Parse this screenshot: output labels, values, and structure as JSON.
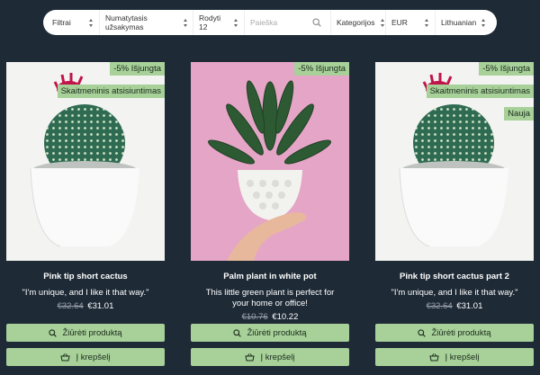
{
  "toolbar": {
    "filters": "Filtrai",
    "sort": "Numatytasis užsakymas",
    "show": "Rodyti 12",
    "search_placeholder": "Paieška",
    "categories": "Kategorijos",
    "currency": "EUR",
    "language": "Lithuanian"
  },
  "colors": {
    "background": "#1e2a36",
    "accent": "#a7d199"
  },
  "products": [
    {
      "title": "Pink tip short cactus",
      "description": "\"I'm unique, and I like it that way.\"",
      "old_price": "€32.64",
      "price": "€31.01",
      "badges": [
        "-5% Išjungta",
        "Skaitmeninis atsisiuntimas"
      ],
      "view_label": "Žiūrėti produktą",
      "cart_label": "Į krepšelį"
    },
    {
      "title": "Palm plant in white pot",
      "description": "This little green plant is perfect for your home or office!",
      "old_price": "€10.76",
      "price": "€10.22",
      "badges": [
        "-5% Išjungta"
      ],
      "view_label": "Žiūrėti produktą",
      "cart_label": "Į krepšelį"
    },
    {
      "title": "Pink tip short cactus part 2",
      "description": "\"I'm unique, and I like it that way.\"",
      "old_price": "€32.64",
      "price": "€31.01",
      "badges": [
        "-5% Išjungta",
        "Skaitmeninis atsisiuntimas",
        "Nauja"
      ],
      "view_label": "Žiūrėti produktą",
      "cart_label": "Į krepšelį"
    }
  ]
}
